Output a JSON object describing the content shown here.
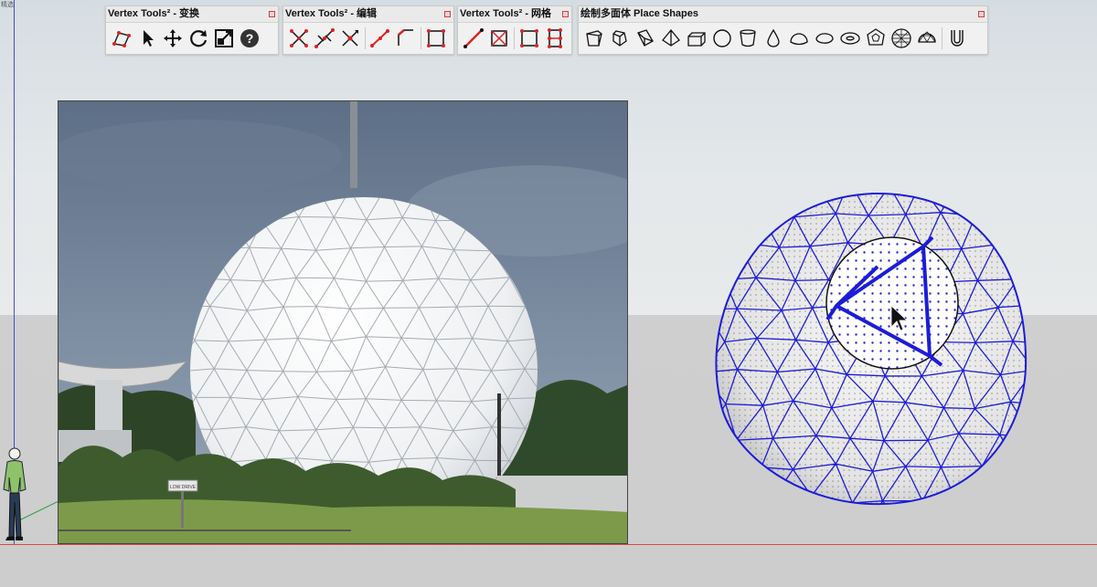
{
  "corner_label": "精选",
  "toolbars": [
    {
      "title": "Vertex Tools² - 变换",
      "icons": [
        "select-vertices-icon",
        "pointer-icon",
        "move-icon",
        "rotate-icon",
        "scale-icon",
        "help-icon"
      ]
    },
    {
      "title": "Vertex Tools² - 编辑",
      "icons": [
        "merge-vertices-icon",
        "merge-along-edge-icon",
        "collapse-icon",
        "connect-vertices-icon",
        "bevel-icon",
        "soft-select-icon"
      ]
    },
    {
      "title": "Vertex Tools² - 网格",
      "icons": [
        "connect-edge-icon",
        "triangulate-icon",
        "grid-icon",
        "subdivide-icon"
      ]
    },
    {
      "title": "绘制多面体 Place Shapes",
      "icons": [
        "cube-icon",
        "hexagon-icon",
        "prism-icon",
        "pyramid-icon",
        "cylinder-icon",
        "circle-icon",
        "cone-icon",
        "teardrop-icon",
        "dome-icon",
        "capsule-icon",
        "torus-icon",
        "dodecahedron-icon",
        "geosphere-icon",
        "hemisphere-icon",
        "tube-icon"
      ]
    }
  ],
  "photo": {
    "subject": "geodesic radome",
    "sign_text": "LOW DRIVE"
  },
  "colors": {
    "edge_blue": "#1c1cd8",
    "axis_red": "#d44a4a",
    "axis_green": "#2f9d3f",
    "axis_blue": "#3a4fd0"
  }
}
